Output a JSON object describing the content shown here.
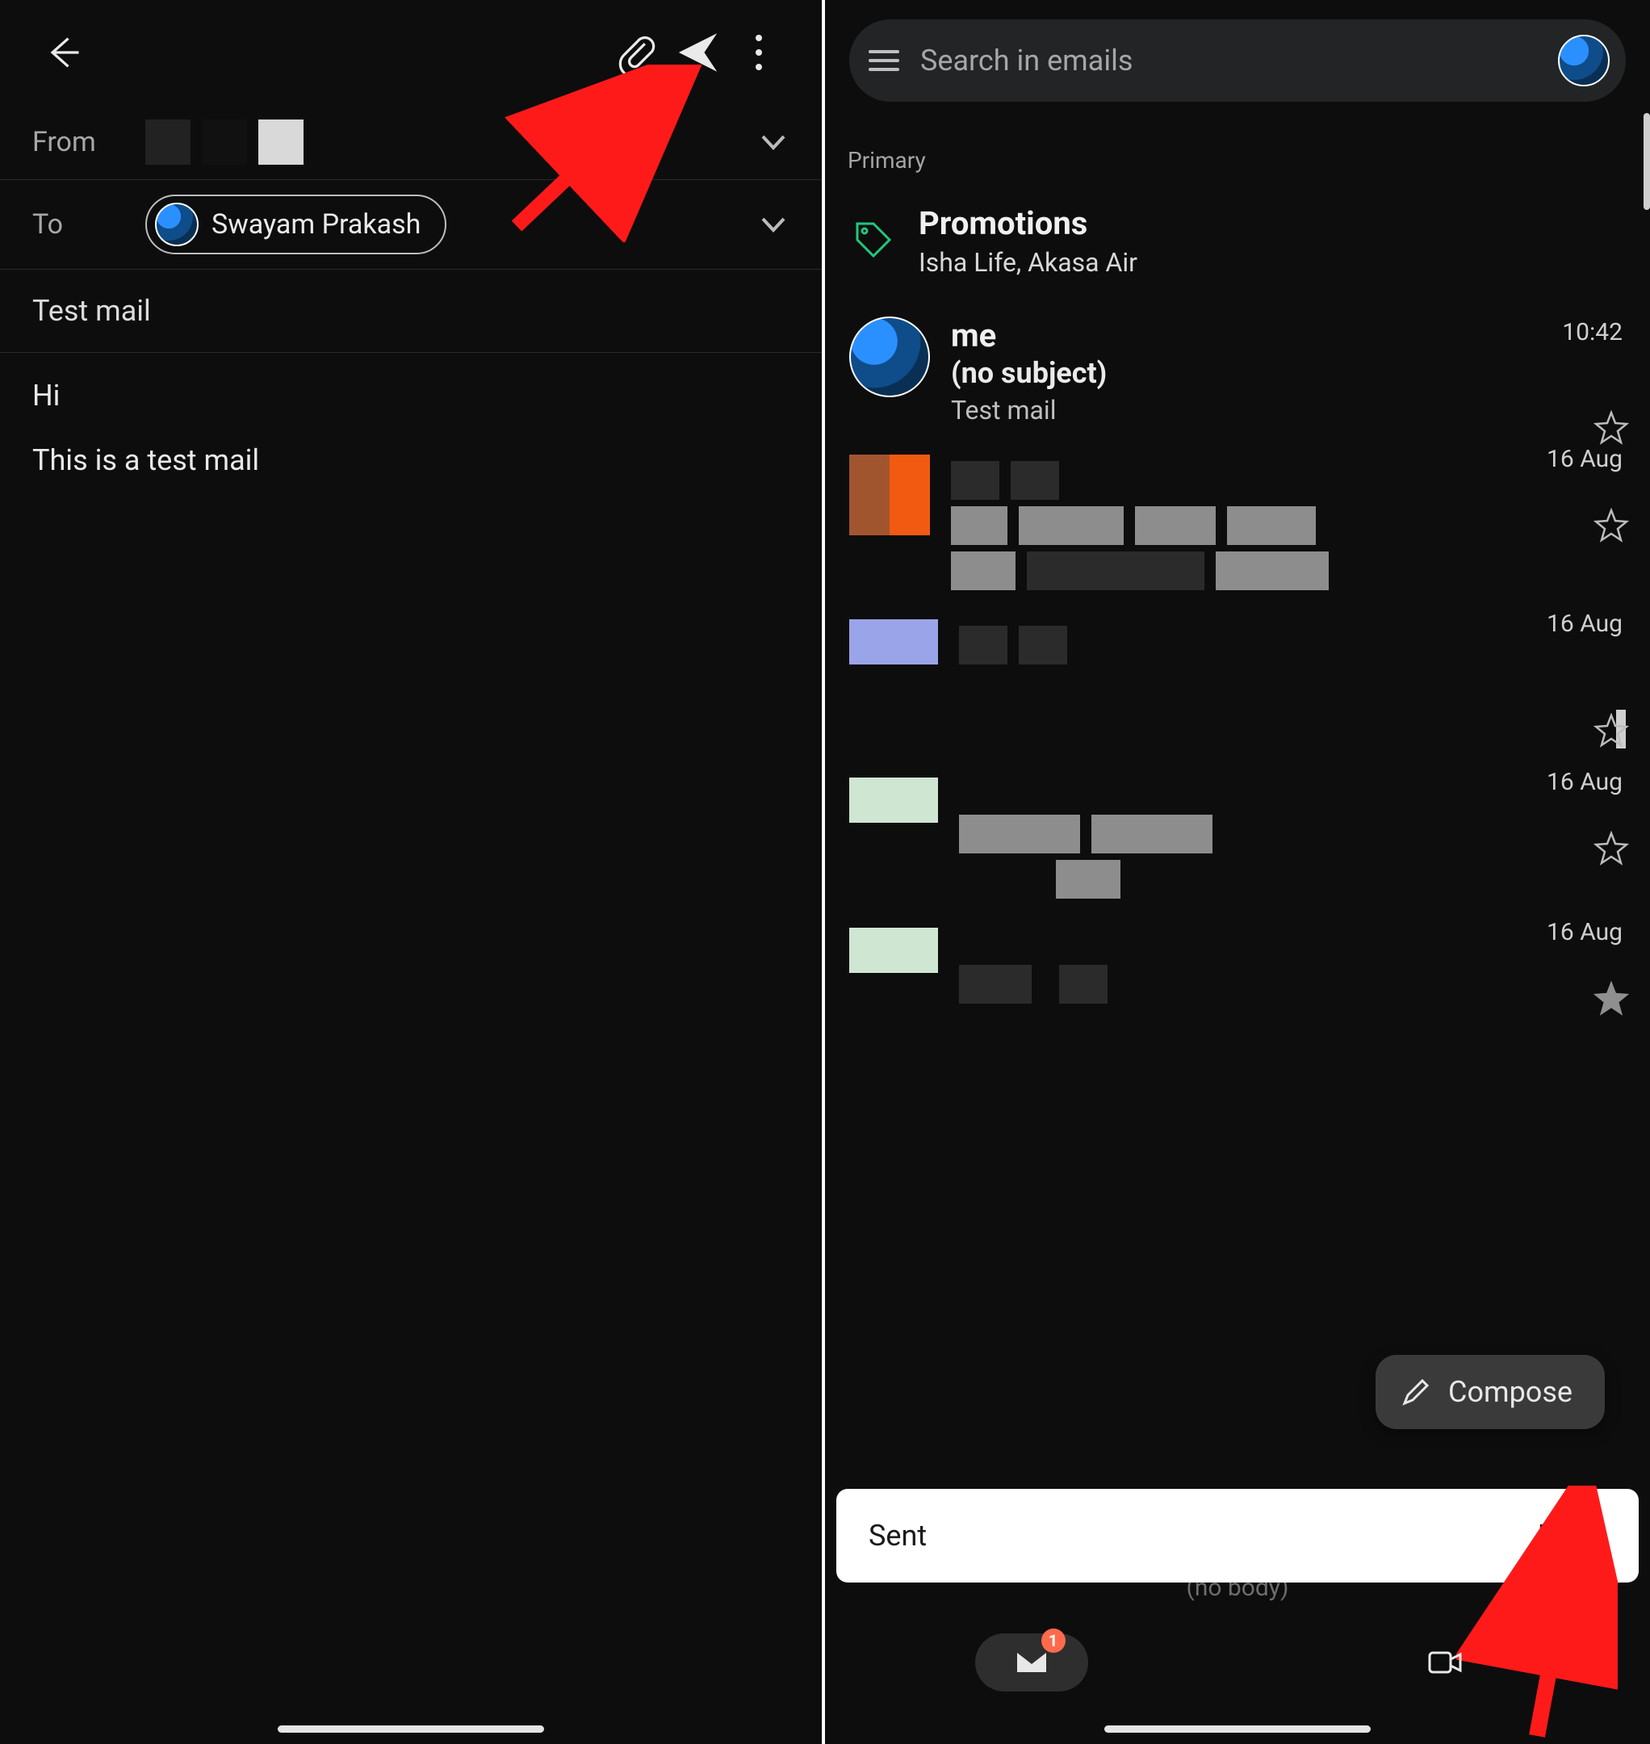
{
  "left": {
    "from_label": "From",
    "to_label": "To",
    "to_chip": "Swayam Prakash",
    "subject": "Test mail",
    "body_line1": "Hi",
    "body_line2": "This is a test mail"
  },
  "right": {
    "search_placeholder": "Search in emails",
    "section_label": "Primary",
    "promotions": {
      "title": "Promotions",
      "sub": "Isha Life, Akasa Air"
    },
    "mail_me": {
      "sender": "me",
      "subject": "(no subject)",
      "snippet": "Test mail",
      "time": "10:42"
    },
    "dates": {
      "d1": "16 Aug",
      "d2": "16 Aug",
      "d3": "16 Aug",
      "d4": "16 Aug"
    },
    "compose": "Compose",
    "snackbar": {
      "msg": "Sent",
      "action": "Undo"
    },
    "under": "(no body)",
    "badge": "1"
  }
}
